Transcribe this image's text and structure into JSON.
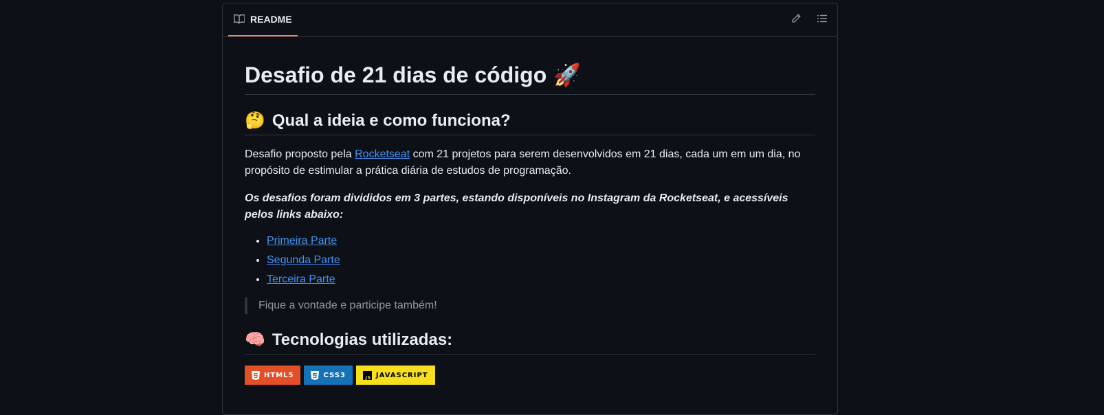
{
  "readme_tab": {
    "label": "README",
    "icon": "book-icon"
  },
  "header_icons": [
    "pencil-icon",
    "list-icon"
  ],
  "title": {
    "text": "Desafio de 21 dias de código",
    "emoji": "🚀"
  },
  "section1": {
    "heading": "Qual a ideia e como funciona?",
    "emoji": "🤔",
    "para_before": "Desafio proposto pela ",
    "link": "Rocketseat",
    "para_after": " com 21 projetos para serem desenvolvidos em 21 dias, cada um em um dia, no propósito de estimular a prática diária de estudos de programação.",
    "emphasis": "Os desafios foram divididos em 3 partes, estando disponíveis no Instagram da Rocketseat, e acessíveis pelos links abaixo:",
    "links": [
      "Primeira Parte",
      "Segunda Parte",
      "Terceira Parte"
    ],
    "quote": "Fique a vontade e participe também!"
  },
  "section2": {
    "heading": "Tecnologias utilizadas:",
    "emoji": "🧠",
    "badges": [
      {
        "label": "HTML5",
        "color": "#e34f26",
        "icon": "html5-icon"
      },
      {
        "label": "CSS3",
        "color": "#1572b6",
        "icon": "css3-icon"
      },
      {
        "label": "JAVASCRIPT",
        "color": "#f7df1e",
        "icon": "javascript-icon"
      }
    ]
  }
}
